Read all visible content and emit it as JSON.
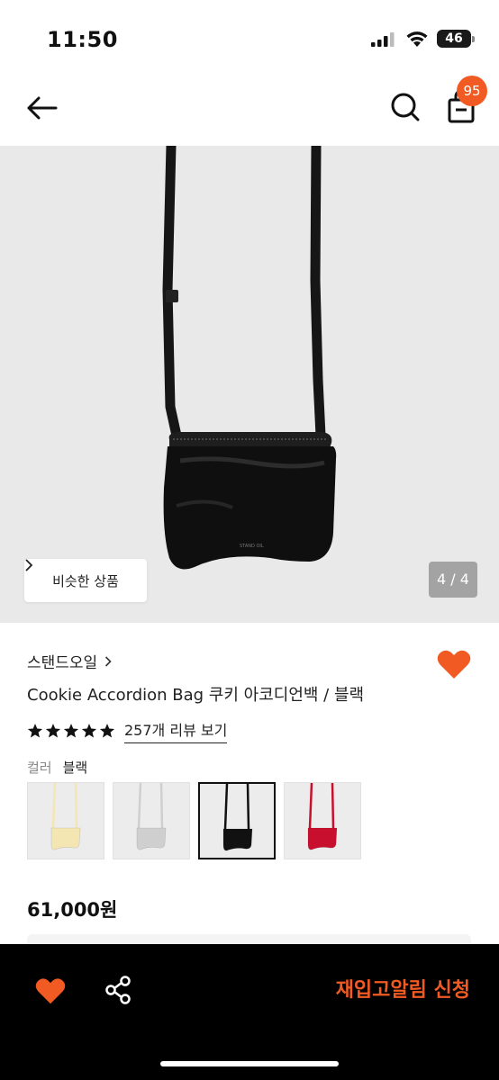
{
  "status_bar": {
    "time": "11:50",
    "battery": "46"
  },
  "header": {
    "cart_count": "95",
    "back_icon": "arrow-left-icon",
    "search_icon": "search-icon",
    "cart_icon": "shopping-bag-icon"
  },
  "gallery": {
    "similar_label": "비슷한 상품",
    "page_indicator": "4 / 4",
    "logo_text": "STAND OIL"
  },
  "product": {
    "brand": "스탠드오일",
    "name": "Cookie Accordion Bag 쿠키 아코디언백 / 블랙",
    "rating": 5,
    "review_label": "257개 리뷰 보기",
    "color_label": "컬러",
    "color_value": "블랙",
    "swatches": [
      {
        "color": "#f3e6b3"
      },
      {
        "color": "#cfcfcf"
      },
      {
        "color": "#111111"
      },
      {
        "color": "#c8102e"
      }
    ],
    "selected_swatch": 2,
    "price": "61,000원"
  },
  "bottom_bar": {
    "restock_label": "재입고알림 신청",
    "accent": "#f15a22"
  }
}
